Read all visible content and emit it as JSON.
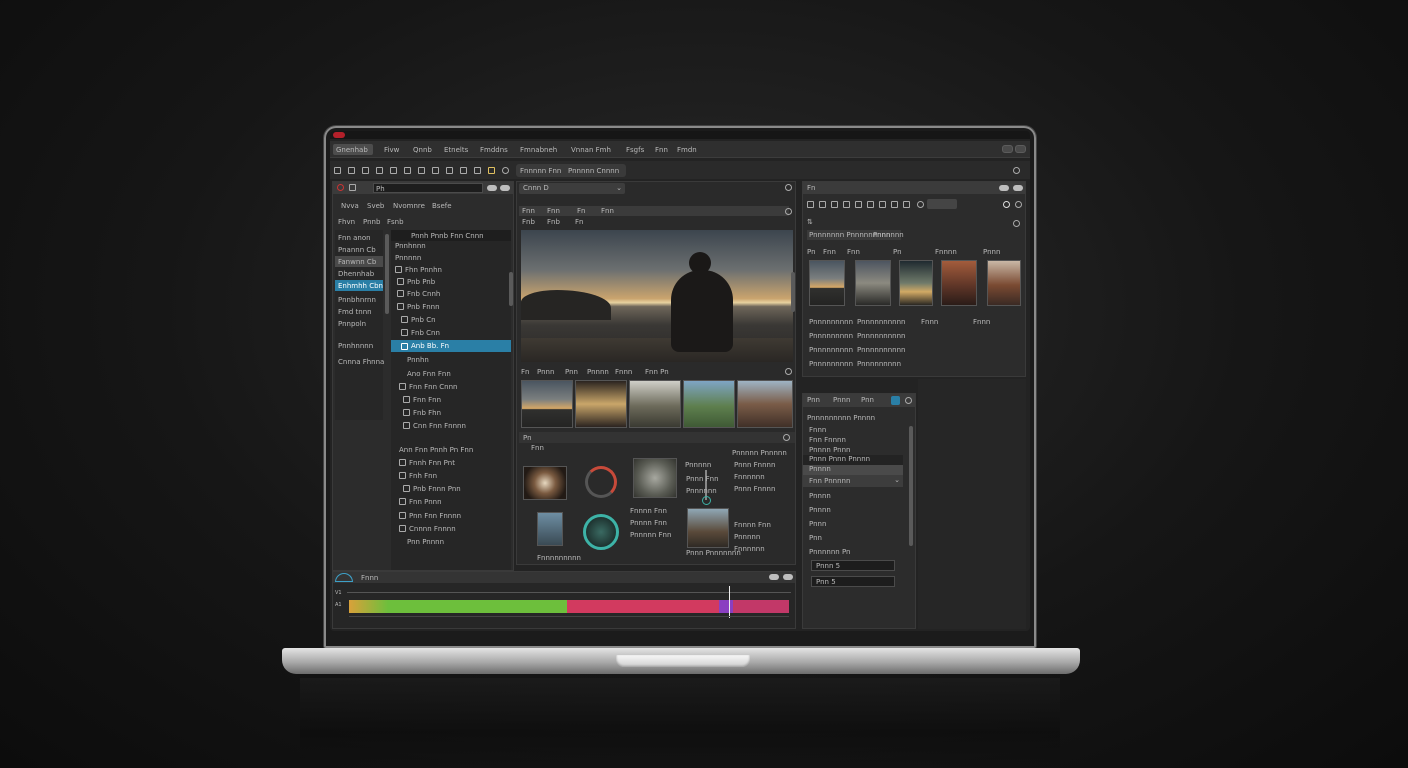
{
  "menu": {
    "items": [
      "Gnenhab",
      "Fivw",
      "Qnnb",
      "Etnelts",
      "Fmddns",
      "Fmnabneh",
      "Vnnan Fmh",
      "Fsgfs",
      "Fnn",
      "Fmdn"
    ]
  },
  "left_panel": {
    "title": "Ph",
    "tabs": [
      "Nvva",
      "Sveb",
      "Nvomnre",
      "Bsefe"
    ],
    "subtabs": [
      "Fhvn",
      "Pnnb",
      "Fsnb"
    ],
    "categories": [
      "Fnn anon",
      "Pnannn Cb",
      "Fanwnn Cb",
      "Dhennhab",
      "Enhmhh Cbn",
      "Pnnbhnrnn",
      "Fmd tnnn",
      "Pnnpoln",
      "Pnnhnnnn",
      "Cnnna Fhnna"
    ],
    "selected_category": 4
  },
  "tree": {
    "header": "Pnnh Pnnb Fnn Cnnn",
    "items": [
      "Pnnhnnn",
      "Pnnnnn",
      "Fhn Pnnhn",
      "Pnb Pnb",
      "Fnb Cnnh",
      "Pnb Fnnn",
      "Pnb Cn",
      "Fnb Cnn",
      "Anb Bb. Fn",
      "Pnnhn",
      "Ano Fnn Fnn",
      "Fnn Fnn Cnnn",
      "Fnn Fnn",
      "Fnb Fhn",
      "Cnn Fnn Fnnnn",
      "Ann Fnn Pnnh Pn Fnn",
      "Fnnh Fnn Pnt",
      "Fnh Fnn",
      "Pnb Fnnn Pnn",
      "Fnn Pnnn",
      "Pnn Fnn Fnnnn",
      "Cnnnn Fnnnn",
      "Pnn Pnnnn"
    ],
    "selected": 8
  },
  "viewer": {
    "tabs": [
      "Fnnnnn Fnn",
      "Pnnnnn Cnnnn"
    ],
    "dropdown": "Cnnn D",
    "toolbar": [
      "Fnn",
      "Fnn",
      "Fn",
      "Fnn"
    ],
    "subbar": [
      "Fnb",
      "Fnb",
      "Fn"
    ],
    "strip_labels": [
      "Fn",
      "Pnnn",
      "Pnn",
      "Pnnnn",
      "Fnnn",
      "Fnn Pn"
    ],
    "adj_labels": [
      "Pn",
      "Fnn",
      "Fnnnnnnnnn"
    ]
  },
  "bins": {
    "heads": [
      "Pnnnnn",
      "Pnnnnn Pnnnnn"
    ],
    "caption": "Pnnn Pnnnnnnn",
    "list1": [
      "Fnnnn Fnn",
      "Pnnnn Fnn",
      "Pnnnnn Fnn",
      "Pnnn Fnn",
      "Pnnnnnn"
    ],
    "list2": [
      "Pnnn Fnnnn",
      "Fnnnnnn",
      "Pnnn Fnnnn",
      "Fnnnn Fnn",
      "Pnnnnn",
      "Fnnnnnn"
    ]
  },
  "right_panel": {
    "title": "Fn",
    "tabs": [
      "Pnnnnnnn Pnnnnnnnnn",
      "Pnnnnnn"
    ],
    "thumb_labels": [
      "Pn",
      "Fnn",
      "Fnn",
      "Pn",
      "Fnnnn",
      "Pnnn"
    ],
    "meta": [
      "Pnnnnnnnnn",
      "Pnnnnnnnnnn",
      "Fnnn",
      "Fnnn",
      "Pnnnnnnnnn",
      "Pnnnnnnnnnn",
      "Pnnnnnnnnn",
      "Pnnnnnnnnnn",
      "Pnnnnnnnnn",
      "Pnnnnnnnnn"
    ]
  },
  "props": {
    "tabs": [
      "Pnn",
      "Pnnn",
      "Pnn"
    ],
    "header": "Pnnnnnnnnn Pnnnn",
    "items": [
      "Fnnn",
      "Fnn Fnnnn",
      "Pnnnn Pnnn",
      "Pnnn Pnnn Pnnnn",
      "Pnnnn",
      "Fnn Pnnnnn"
    ],
    "list": [
      "Pnnnn",
      "Pnnnn",
      "Pnnn",
      "Pnn",
      "Pnnnnnn Pn"
    ],
    "fields": [
      "Pnnn 5",
      "Pnn 5"
    ]
  },
  "timeline": {
    "title": "Fnnn",
    "tracks": [
      "V1",
      "A1"
    ]
  },
  "colors": {
    "accent": "#2a7fa6",
    "panel": "#2c2c2c",
    "track_green": "#6dbf3c",
    "track_red": "#d23a5f",
    "track_purple": "#8a3fc1"
  }
}
